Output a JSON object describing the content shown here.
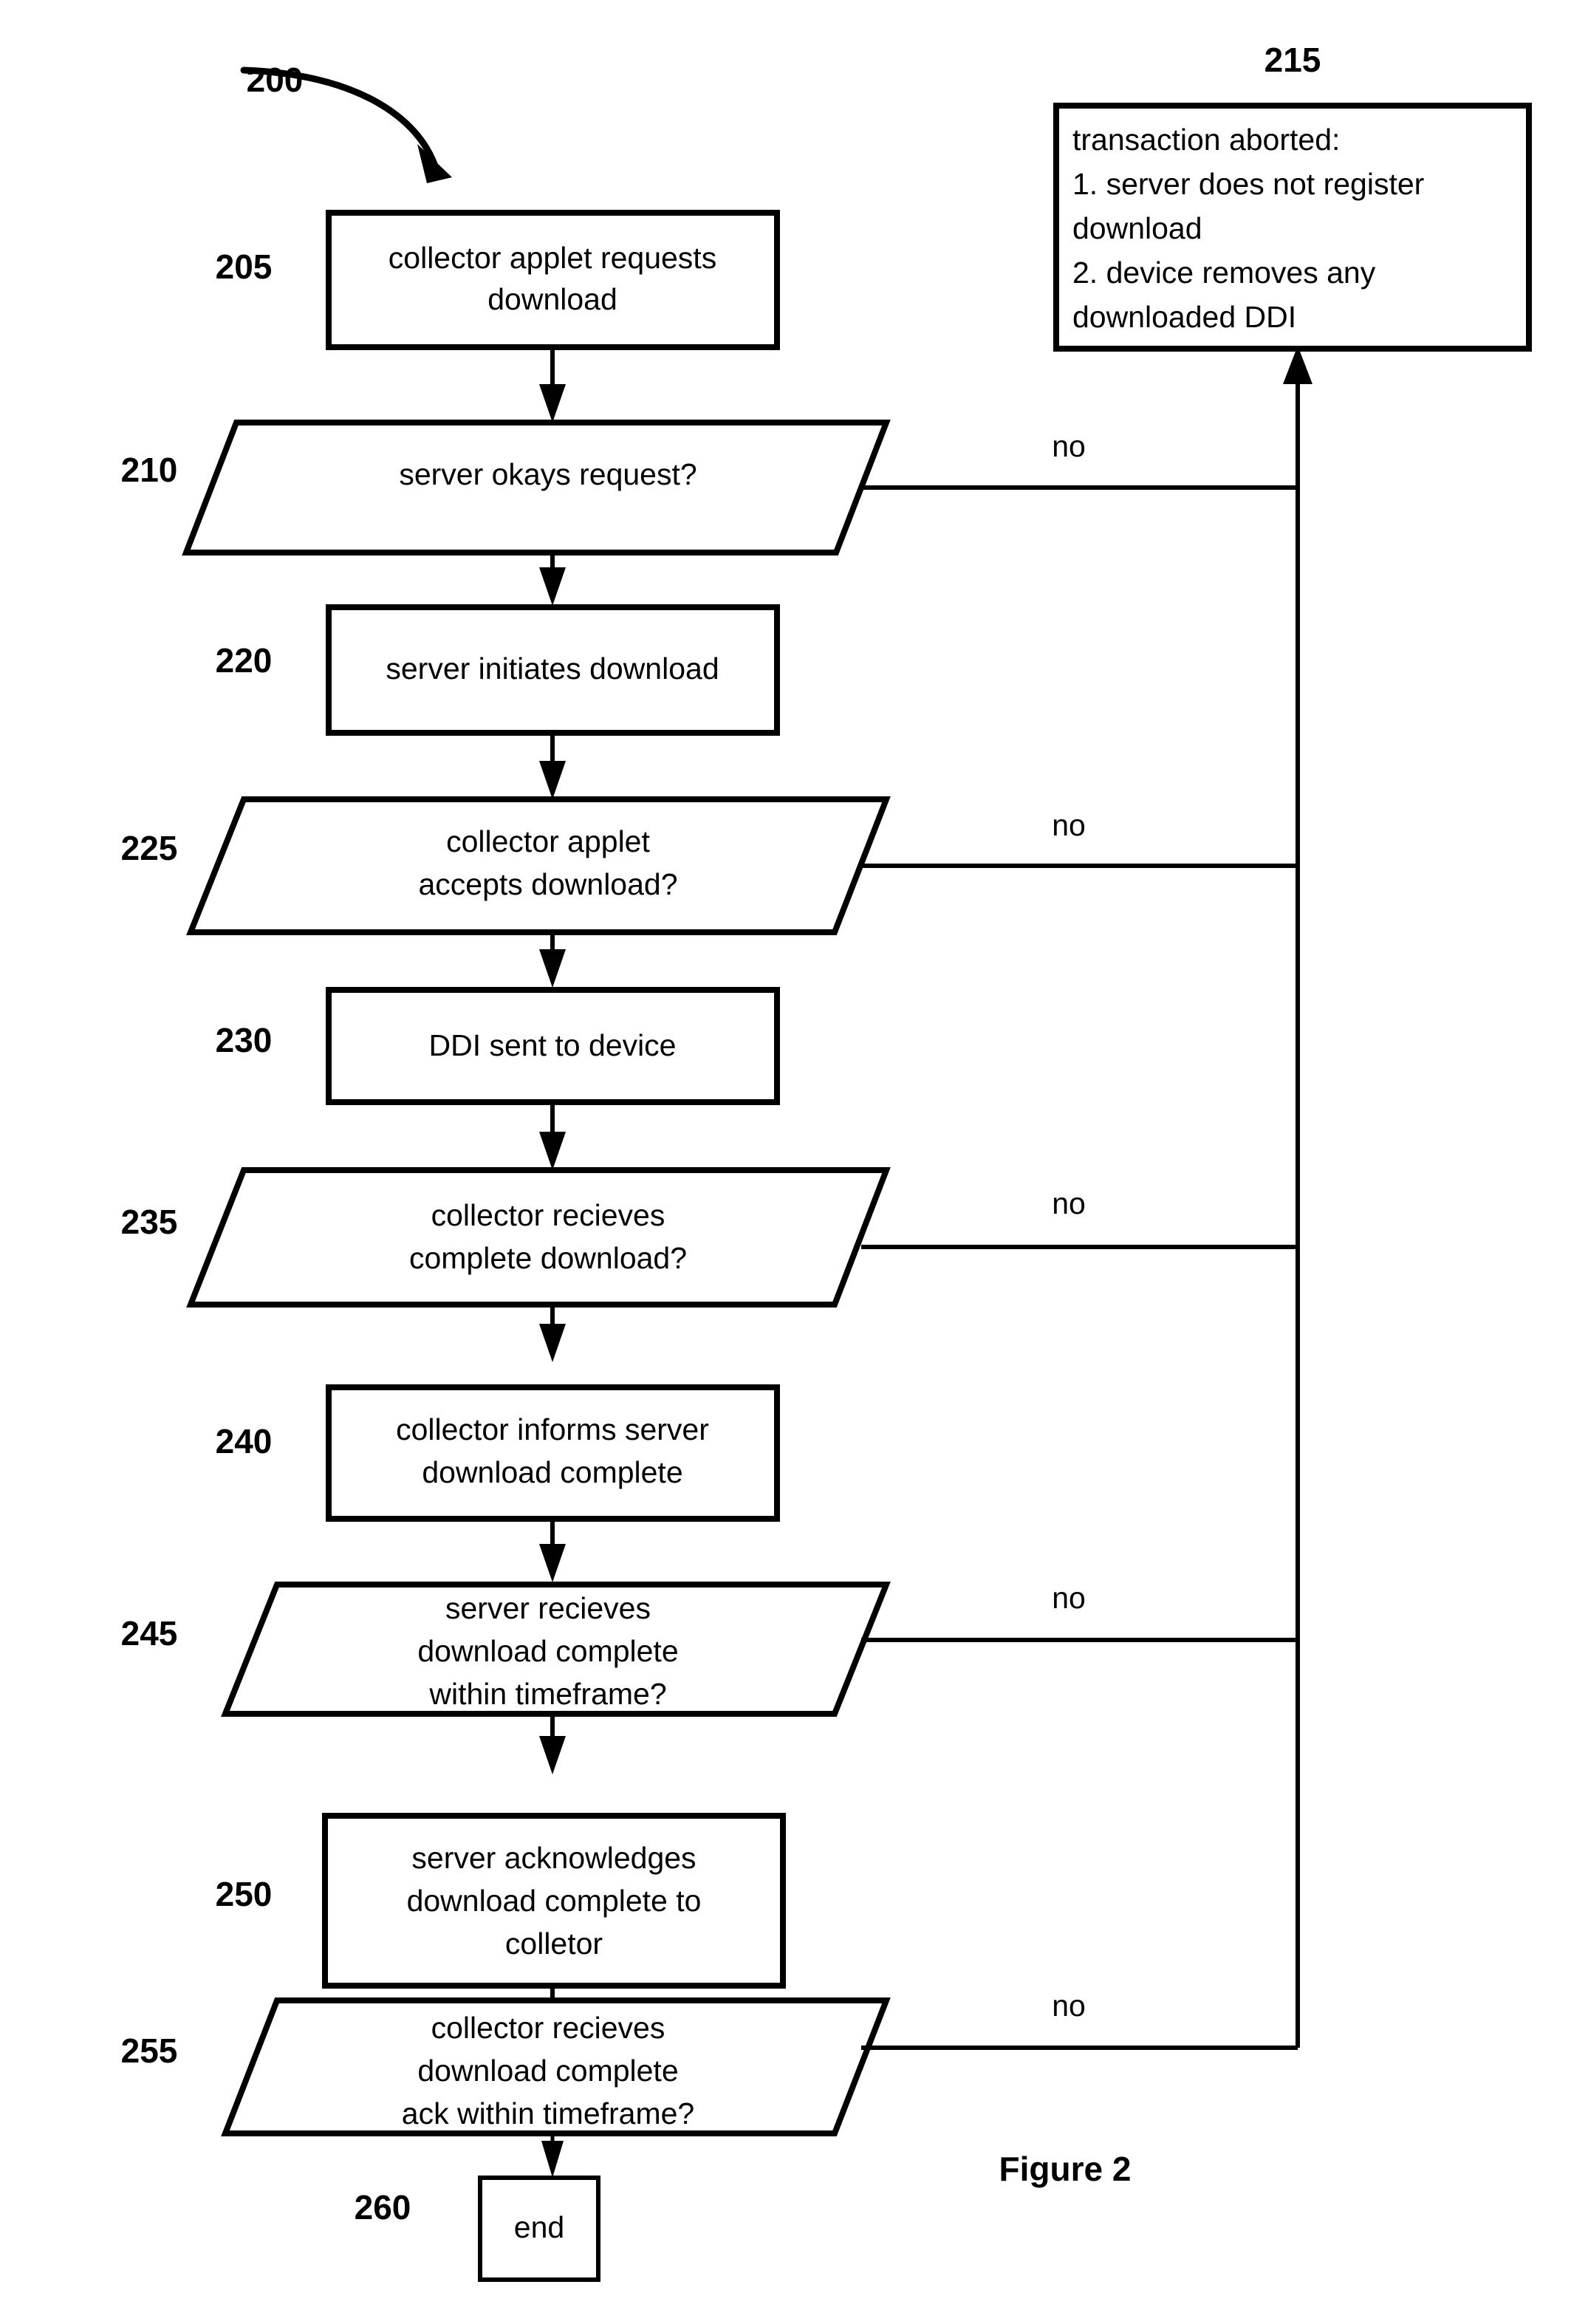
{
  "figure": {
    "caption": "Figure 2",
    "diagram_ref": "200"
  },
  "abort_box": {
    "ref": "215",
    "lines": [
      "transaction aborted:",
      "1. server does not register",
      "download",
      "2. device removes any",
      "downloaded DDI"
    ]
  },
  "branch_label": "no",
  "nodes": [
    {
      "ref": "205",
      "type": "process",
      "lines": [
        "collector applet requests",
        "download"
      ]
    },
    {
      "ref": "210",
      "type": "decision",
      "lines": [
        "server okays request?"
      ]
    },
    {
      "ref": "220",
      "type": "process",
      "lines": [
        "server initiates download"
      ]
    },
    {
      "ref": "225",
      "type": "decision",
      "lines": [
        "collector applet",
        "accepts download?"
      ]
    },
    {
      "ref": "230",
      "type": "process",
      "lines": [
        "DDI sent to device"
      ]
    },
    {
      "ref": "235",
      "type": "decision",
      "lines": [
        "collector recieves",
        "complete download?"
      ]
    },
    {
      "ref": "240",
      "type": "process",
      "lines": [
        "collector informs server",
        "download complete"
      ]
    },
    {
      "ref": "245",
      "type": "decision",
      "lines": [
        "server recieves",
        "download complete",
        "within timeframe?"
      ]
    },
    {
      "ref": "250",
      "type": "process",
      "lines": [
        "server acknowledges",
        "download complete to",
        "colletor"
      ]
    },
    {
      "ref": "255",
      "type": "decision",
      "lines": [
        "collector recieves",
        "download complete",
        "ack within timeframe?"
      ]
    },
    {
      "ref": "260",
      "type": "terminal",
      "lines": [
        "end"
      ]
    }
  ],
  "colors": {
    "stroke": "#000000",
    "fill": "#ffffff"
  }
}
